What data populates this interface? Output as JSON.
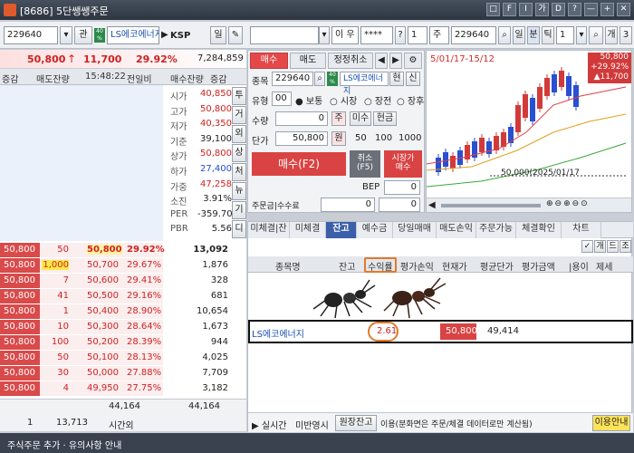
{
  "window": {
    "title": "[8686] 5단쌩쌩주문",
    "buttons": [
      "□",
      "F",
      "I",
      "가",
      "D",
      "?",
      "—",
      "+",
      "✕"
    ]
  },
  "toolbar": {
    "code": "229640",
    "code_btn": "관",
    "stock_name": "LS에코에너지",
    "market": "KSP",
    "btn_day": "일",
    "right_code_empty": "",
    "account_holder": "이 우",
    "password_mask": "****",
    "qty_sel": "1",
    "stock_type": "주",
    "code2": "229640",
    "btn_d": "일",
    "btn_m": "분",
    "btn_t": "틱",
    "interval": "1",
    "btn_ge": "개",
    "btn_3": "3"
  },
  "price": {
    "last": "50,800",
    "arrow": "↑",
    "change": "11,700",
    "rate": "29.92%",
    "volume": "7,284,859"
  },
  "book_header": [
    "증감",
    "매도잔량",
    "15:48:22",
    "전일비",
    "매수잔량",
    "증감"
  ],
  "asks": [],
  "info": [
    {
      "label": "시가",
      "value": "40,850",
      "color": "red"
    },
    {
      "label": "고가",
      "value": "50,800",
      "color": "red"
    },
    {
      "label": "저가",
      "value": "40,350",
      "color": "red"
    },
    {
      "label": "기준",
      "value": "39,100",
      "color": "black"
    },
    {
      "label": "상가",
      "value": "50,800",
      "color": "red"
    },
    {
      "label": "하가",
      "value": "27,400",
      "color": "blue"
    },
    {
      "label": "가중",
      "value": "47,258",
      "color": "red"
    },
    {
      "label": "소진",
      "value": "3.91%",
      "color": "black"
    },
    {
      "label": "PER",
      "value": "-359.70",
      "color": "black"
    },
    {
      "label": "PBR",
      "value": "5.56",
      "color": "black"
    }
  ],
  "side_tabs": [
    "투",
    "거",
    "외",
    "상",
    "처",
    "뉴",
    "기",
    "디"
  ],
  "top_bid": {
    "qty": "50",
    "price": "50,800",
    "rate": "29.92%",
    "bid_qty": "13,092"
  },
  "bids": [
    {
      "left_price": "50,800",
      "qty": "50",
      "price": "50,800",
      "rate": "29.92%",
      "bid": "13,092"
    },
    {
      "left_price": "50,800",
      "qty": "1,000",
      "price": "50,700",
      "rate": "29.67%",
      "bid": "1,876"
    },
    {
      "left_price": "50,800",
      "qty": "7",
      "price": "50,600",
      "rate": "29.41%",
      "bid": "328"
    },
    {
      "left_price": "50,800",
      "qty": "41",
      "price": "50,500",
      "rate": "29.16%",
      "bid": "681"
    },
    {
      "left_price": "50,800",
      "qty": "1",
      "price": "50,400",
      "rate": "28.90%",
      "bid": "10,654"
    },
    {
      "left_price": "50,800",
      "qty": "10",
      "price": "50,300",
      "rate": "28.64%",
      "bid": "1,673"
    },
    {
      "left_price": "50,800",
      "qty": "100",
      "price": "50,200",
      "rate": "28.39%",
      "bid": "944"
    },
    {
      "left_price": "50,800",
      "qty": "50",
      "price": "50,100",
      "rate": "28.13%",
      "bid": "4,025"
    },
    {
      "left_price": "50,800",
      "qty": "30",
      "price": "50,000",
      "rate": "27.88%",
      "bid": "7,709"
    },
    {
      "left_price": "50,800",
      "qty": "4",
      "price": "49,950",
      "rate": "27.75%",
      "bid": "3,182"
    }
  ],
  "totals": {
    "ask_total": "44,164",
    "bid_total": "44,164",
    "trades": "1",
    "trade_total": "13,713",
    "mode": "시간외"
  },
  "order": {
    "tab_buy": "매수",
    "tab_sell": "매도",
    "tab_modify": "정정취소",
    "code": "229640",
    "name": "LS에코에너지",
    "cur_btn": "현",
    "credit_btn": "신",
    "type_label": "유형",
    "type_value": "00",
    "radio_normal": "보통",
    "radio_market": "시장",
    "radio_pre": "장전",
    "radio_after": "장후",
    "qty_label": "수량",
    "qty_value": "0",
    "qty_btn": "주",
    "unfilled_btn": "미수",
    "cash_btn": "현금",
    "price_label": "단가",
    "price_value": "50,800",
    "price_btn": "원",
    "step1": "50",
    "step2": "100",
    "step3": "1000",
    "submit": "매수(F2)",
    "cancel": "취소\n(F5)",
    "market_buy": "시장가\n매수",
    "bep_label": "BEP",
    "bep_value": "0",
    "avail_label": "주문금|수수료",
    "avail_value": "0",
    "fee_value": "0"
  },
  "chart": {
    "period": "5/01/17-15/12",
    "price_box": "50,800",
    "rate_box": "+29.92%",
    "change_box": "▲11,700",
    "low_label": "50,000(2025/01/17"
  },
  "bottom_tabs": [
    "미체결|잔",
    "미체결",
    "잔고",
    "예수금",
    "당일매매",
    "매도손익",
    "주문가능",
    "체결확인",
    "차트"
  ],
  "active_tab": "잔고",
  "holdings_header": [
    "종목명",
    "잔고",
    "수익률",
    "평가손익",
    "현재가",
    "평균단가",
    "평가금액",
    "|용이",
    "제세"
  ],
  "holding": {
    "name": "LS에코에너지",
    "qty": "",
    "rate": "2.61",
    "pnl": "",
    "price": "50,800",
    "avg": "49,414",
    "eval": ""
  },
  "toggle_buttons": [
    "✓",
    "개",
    "드",
    "조"
  ],
  "status_bar": {
    "realtime": "실시간",
    "unreflected": "미반영시",
    "original_btn": "원장잔고",
    "note": "이용(분화면은 주문/체결 데이터로만 계산됨)",
    "guide_btn": "이용안내"
  },
  "bottom_bar": "주식주문 추가 · 유의사항 안내"
}
